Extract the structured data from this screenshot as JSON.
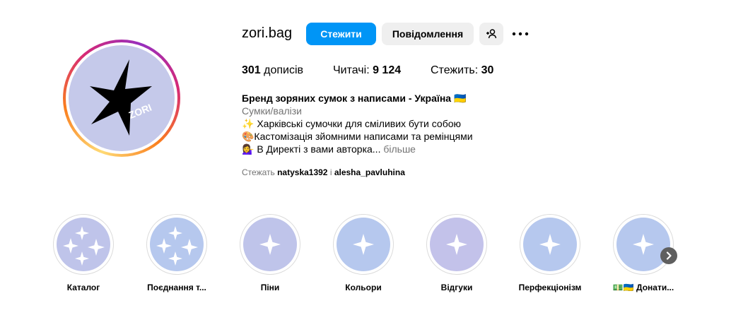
{
  "profile": {
    "username": "zori.bag",
    "follow_label": "Стежити",
    "message_label": "Повідомлення",
    "add_user_icon": "person-add-icon",
    "more_icon": "more-horizontal-icon"
  },
  "stats": {
    "posts_count": "301",
    "posts_label": " дописів",
    "followers_label": "Читачі: ",
    "followers_count": "9 124",
    "following_label": "Стежить: ",
    "following_count": "30"
  },
  "bio": {
    "name": "Бренд зоряних сумок з написами - Україна 🇺🇦",
    "category": "Сумки/валізи",
    "line1": "✨ Харківські сумочки для сміливих бути собою",
    "line2": "🎨Кастомізація зйомними написами та ремінцями",
    "line3": "💁‍♀️ В Директі з вами авторка... ",
    "more_label": "більше"
  },
  "followed_by": {
    "prefix": "Стежать ",
    "user1": "natyska1392",
    "separator": " і ",
    "user2": "alesha_pavluhina"
  },
  "avatar": {
    "brand_text": "ZORI",
    "background": "#c5c9ea"
  },
  "highlights": [
    {
      "label": "Каталог",
      "color": "#bfc4ea",
      "stars": 4
    },
    {
      "label": "Поєднання т...",
      "color": "#b6c8ee",
      "stars": 4
    },
    {
      "label": "Піни",
      "color": "#bfc4ea",
      "stars": 1
    },
    {
      "label": "Кольори",
      "color": "#b6c8ee",
      "stars": 1
    },
    {
      "label": "Відгуки",
      "color": "#c3c2ea",
      "stars": 1
    },
    {
      "label": "Перфекціонізм",
      "color": "#b6c8ee",
      "stars": 1
    },
    {
      "label": "💵🇺🇦 Донати...",
      "color": "#b6c8ee",
      "stars": 1
    }
  ],
  "colors": {
    "accent": "#0095f6",
    "secondary_button": "#efefef",
    "muted_text": "#737373"
  }
}
